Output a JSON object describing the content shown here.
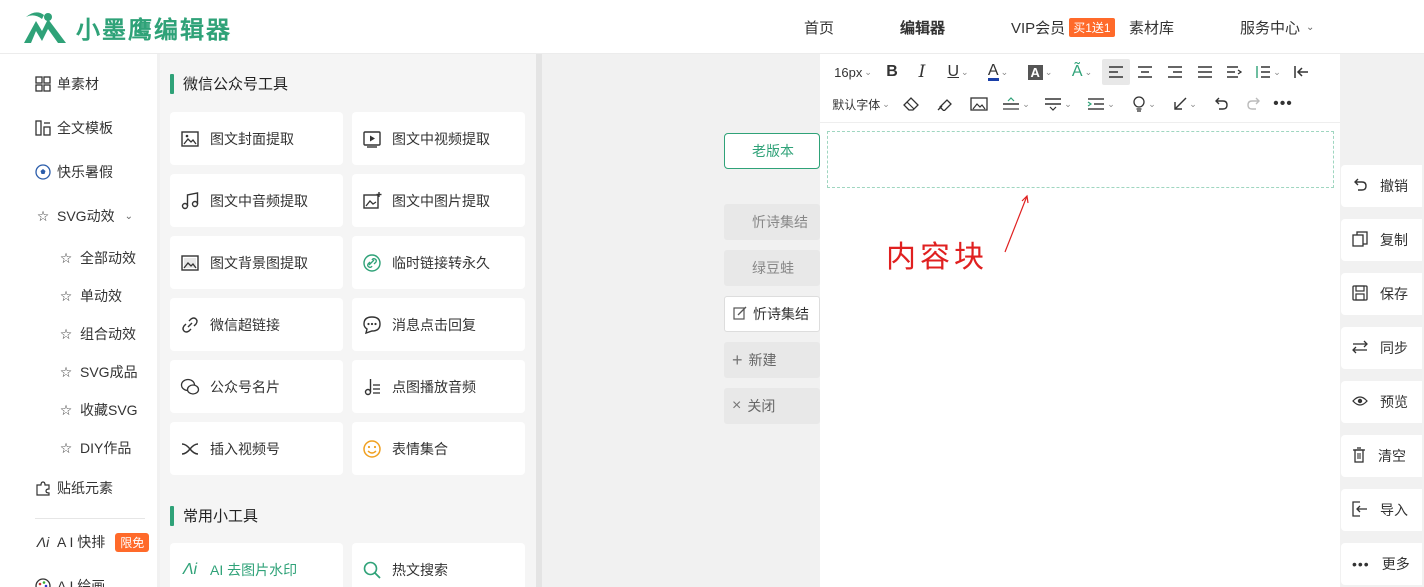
{
  "brand": {
    "name": "小墨鹰编辑器",
    "color": "#2fa278"
  },
  "nav": {
    "home": "首页",
    "editor": "编辑器",
    "vip": "VIP会员",
    "vip_badge": "买1送1",
    "materials": "素材库",
    "service": "服务中心"
  },
  "sidebar": {
    "items": [
      {
        "label": "单素材",
        "icon": "grid-icon"
      },
      {
        "label": "全文模板",
        "icon": "layout-icon"
      },
      {
        "label": "快乐暑假",
        "icon": "soccer-ball-icon"
      },
      {
        "label": "SVG动效",
        "icon": "star-icon"
      },
      {
        "label": "全部动效",
        "icon": "star-icon"
      },
      {
        "label": "单动效",
        "icon": "star-icon"
      },
      {
        "label": "组合动效",
        "icon": "star-icon"
      },
      {
        "label": "SVG成品",
        "icon": "star-icon"
      },
      {
        "label": "收藏SVG",
        "icon": "star-icon"
      },
      {
        "label": "DIY作品",
        "icon": "star-icon"
      },
      {
        "label": "贴纸元素",
        "icon": "puzzle-icon"
      },
      {
        "label": "A I 快排",
        "icon": "ai-icon",
        "badge": "限免"
      },
      {
        "label": "A I 绘画",
        "icon": "palette-icon"
      }
    ]
  },
  "tools": {
    "section1": "微信公众号工具",
    "section2": "常用小工具",
    "cards": [
      {
        "label": "图文封面提取",
        "icon": "image-icon"
      },
      {
        "label": "图文中视频提取",
        "icon": "video-icon"
      },
      {
        "label": "图文中音频提取",
        "icon": "music-icon"
      },
      {
        "label": "图文中图片提取",
        "icon": "image-plus-icon"
      },
      {
        "label": "图文背景图提取",
        "icon": "image-icon"
      },
      {
        "label": "临时链接转永久",
        "icon": "link-icon"
      },
      {
        "label": "微信超链接",
        "icon": "link-icon"
      },
      {
        "label": "消息点击回复",
        "icon": "chat-icon"
      },
      {
        "label": "公众号名片",
        "icon": "wechat-icon"
      },
      {
        "label": "点图播放音频",
        "icon": "music-note-icon"
      },
      {
        "label": "插入视频号",
        "icon": "channels-icon"
      },
      {
        "label": "表情集合",
        "icon": "smile-icon"
      },
      {
        "label": "AI 去图片水印",
        "icon": "ai-icon"
      },
      {
        "label": "热文搜索",
        "icon": "search-icon"
      }
    ]
  },
  "docs": {
    "old_version": "老版本",
    "items": [
      "忻诗集结",
      "绿豆蛙",
      "忻诗集结"
    ],
    "new": "新建",
    "close": "关闭"
  },
  "editor": {
    "font_size": "16px",
    "font_family": "默认字体",
    "annotation": "内容块"
  },
  "actions": [
    "撤销",
    "复制",
    "保存",
    "同步",
    "预览",
    "清空",
    "导入",
    "更多"
  ]
}
